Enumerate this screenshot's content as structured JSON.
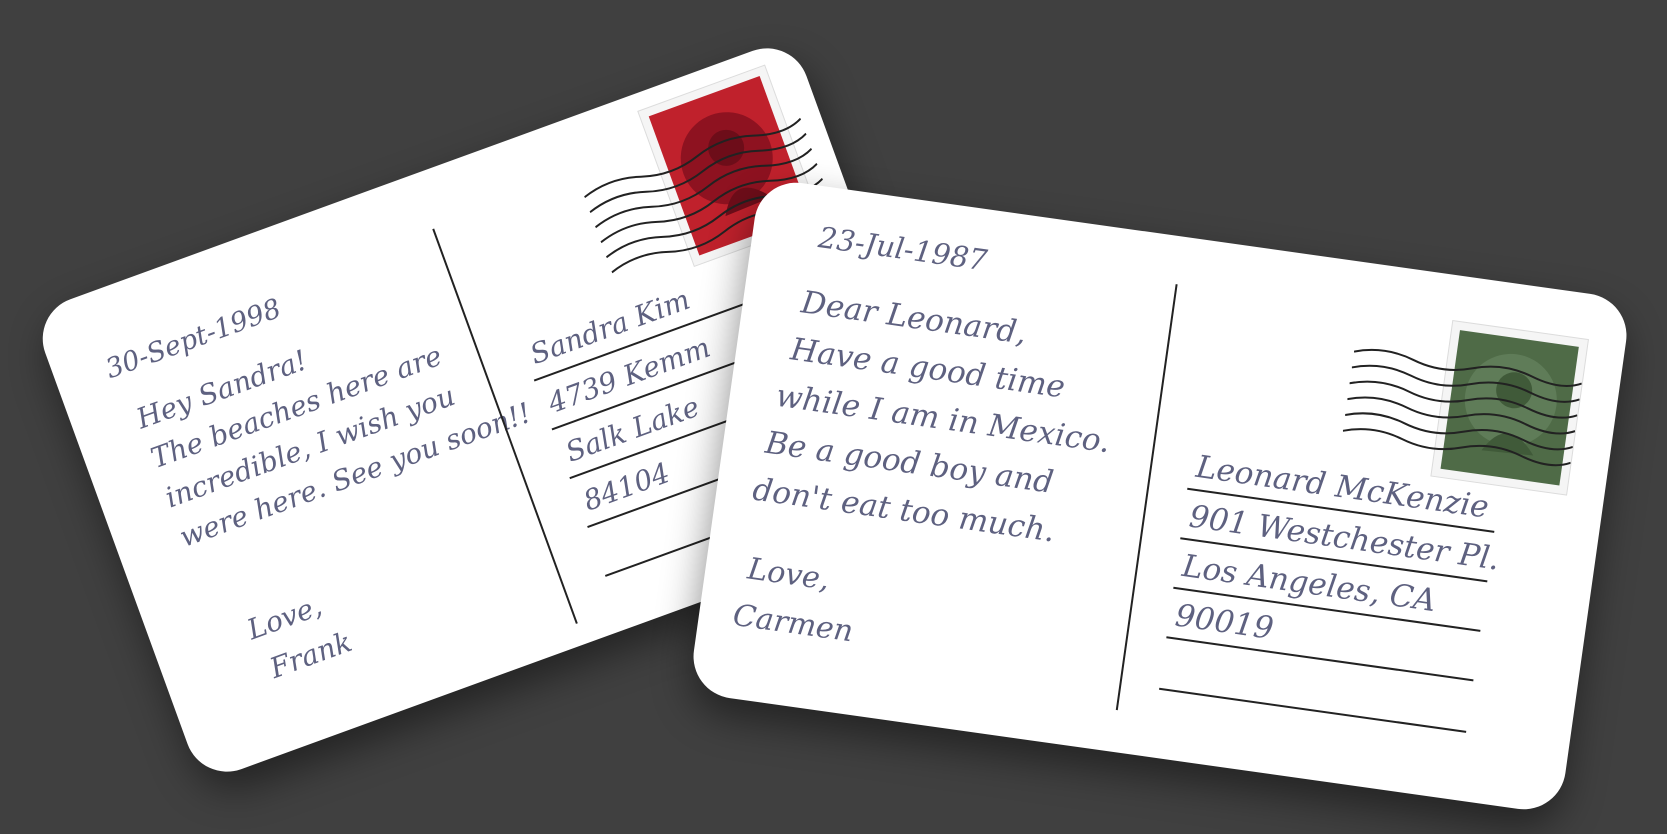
{
  "colors": {
    "background": "#404040",
    "card": "#ffffff",
    "ink": "#5e6180",
    "stamp_red": "#c0212c",
    "stamp_green": "#4f6b47"
  },
  "postcard_back": {
    "date": "30-Sept-1998",
    "message_lines": [
      "Hey Sandra!",
      "The beaches here are",
      "incredible, I wish you",
      "were here. See you soon!!"
    ],
    "closing": "Love,",
    "signature": "Frank",
    "address_lines": [
      "Sandra Kim",
      "4739 Kemm",
      "Salk Lake",
      "84104"
    ],
    "stamp_icon": "portrait-stamp-icon"
  },
  "postcard_front": {
    "date": "23-Jul-1987",
    "message_lines": [
      "Dear Leonard,",
      "Have a good time",
      "while I am in Mexico.",
      "Be a good boy and",
      "don't eat too much."
    ],
    "closing": "Love,",
    "signature": "Carmen",
    "address_lines": [
      "Leonard McKenzie",
      "901 Westchester Pl.",
      "Los Angeles, CA",
      "90019"
    ],
    "stamp_icon": "portrait-stamp-icon"
  }
}
